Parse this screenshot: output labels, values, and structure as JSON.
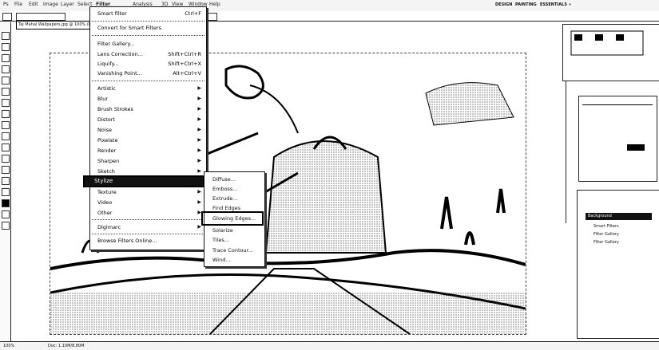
{
  "menubar": {
    "items": [
      "Ps",
      "File",
      "Edit",
      "Image",
      "Layer",
      "Select",
      "Filter",
      "Analysis",
      "3D",
      "View",
      "Window",
      "Help"
    ],
    "workspace_items": [
      "DESIGN",
      "PAINTING",
      "ESSENTIALS",
      "»"
    ]
  },
  "document_tab": {
    "label": "Taj Mahal Wallpapers.jpg @ 100% (RGB/8)"
  },
  "filter_menu": {
    "last_filter": {
      "label": "Smart filter",
      "shortcut": "Ctrl+F"
    },
    "convert_smart": "Convert for Smart Filters",
    "gallery": {
      "label": "Filter Gallery..."
    },
    "lens_correction": {
      "label": "Lens Correction...",
      "shortcut": "Shift+Ctrl+R"
    },
    "liquify": {
      "label": "Liquify...",
      "shortcut": "Shift+Ctrl+X"
    },
    "vanishing_point": {
      "label": "Vanishing Point...",
      "shortcut": "Alt+Ctrl+V"
    },
    "submenus": [
      "Artistic",
      "Blur",
      "Brush Strokes",
      "Distort",
      "Noise",
      "Pixelate",
      "Render",
      "Sharpen",
      "Sketch",
      "Stylize",
      "Texture",
      "Video",
      "Other"
    ],
    "digimarc": "Digimarc",
    "browse_online": "Browse Filters Online..."
  },
  "stylize_submenu": {
    "items": [
      "Diffuse...",
      "Emboss...",
      "Extrude...",
      "Find Edges",
      "Glowing Edges...",
      "Solarize",
      "Tiles...",
      "Trace Contour...",
      "Wind..."
    ]
  },
  "layers_panel": {
    "rows": [
      "Background",
      "Smart Filters",
      "Filter Gallery",
      "Filter Gallery"
    ]
  },
  "status": {
    "zoom": "100%",
    "doc": "Doc: 1.10M/8.80M"
  }
}
